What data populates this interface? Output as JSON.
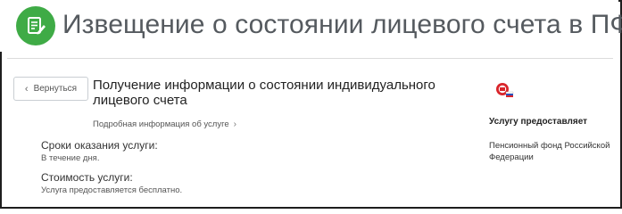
{
  "header": {
    "title": "Извещение о состоянии лицевого счета в ПФР",
    "icon": "document-edit-icon",
    "accent": "#3fab46"
  },
  "nav": {
    "back_label": "Вернуться"
  },
  "service": {
    "title": "Получение информации о состоянии индивидуального лицевого счета",
    "details_link": "Подробная информация об услуге"
  },
  "terms": {
    "duration_label": "Сроки оказания услуги:",
    "duration_value": "В течение дня.",
    "cost_label": "Стоимость услуги:",
    "cost_value": "Услуга предоставляется бесплатно."
  },
  "provider": {
    "label": "Услугу предоставляет",
    "name": "Пенсионный фонд Российской Федерации",
    "logo": "pfr-logo"
  }
}
